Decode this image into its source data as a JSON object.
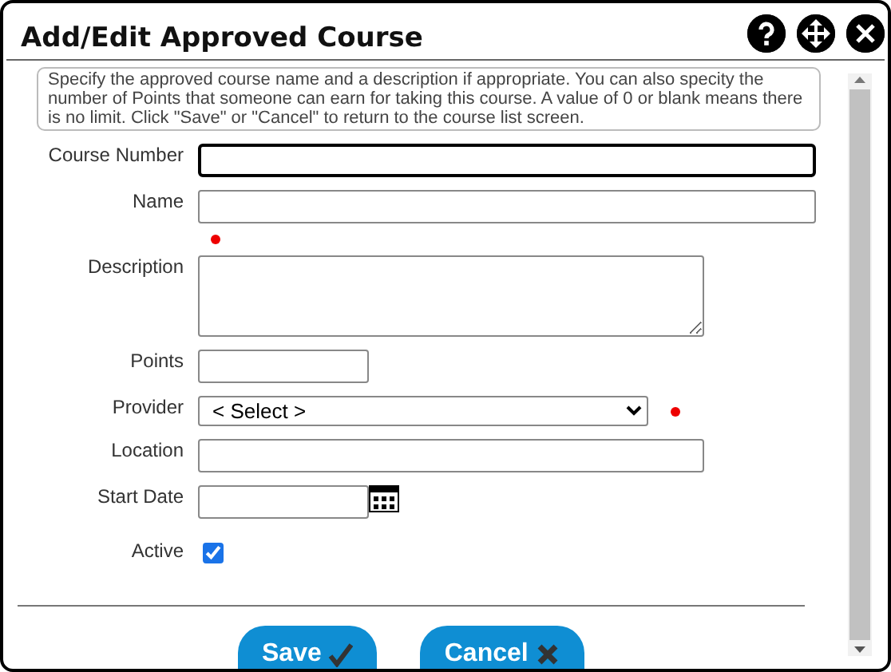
{
  "window": {
    "title": "Add/Edit Approved Course"
  },
  "header_buttons": [
    {
      "kind": "help"
    },
    {
      "kind": "move"
    },
    {
      "kind": "close"
    }
  ],
  "instructions": "Specify the approved course name and a description if appropriate. You can also specity the number of Points that someone can earn for taking this course. A value of 0 or blank means there is no limit. Click \"Save\" or \"Cancel\" to return to the course list screen.",
  "fields": [
    {
      "label": "Course Number",
      "kind": "text",
      "focused": true,
      "required": false
    },
    {
      "label": "Name",
      "kind": "text",
      "focused": false,
      "required": true
    },
    {
      "label": "Description",
      "kind": "textarea",
      "focused": false,
      "required": false
    },
    {
      "label": "Points",
      "kind": "text",
      "focused": false,
      "required": false
    },
    {
      "label": "Provider",
      "kind": "select",
      "value": "< Select >",
      "focused": false,
      "required": true
    },
    {
      "label": "Location",
      "kind": "text",
      "focused": false,
      "required": false
    },
    {
      "label": "Start Date",
      "kind": "date",
      "focused": false,
      "required": false
    },
    {
      "label": "Active",
      "kind": "checkbox",
      "checked": true,
      "required": false
    }
  ],
  "buttons": [
    {
      "label": "Save",
      "kind": "save"
    },
    {
      "label": "Cancel",
      "kind": "cancel"
    }
  ]
}
